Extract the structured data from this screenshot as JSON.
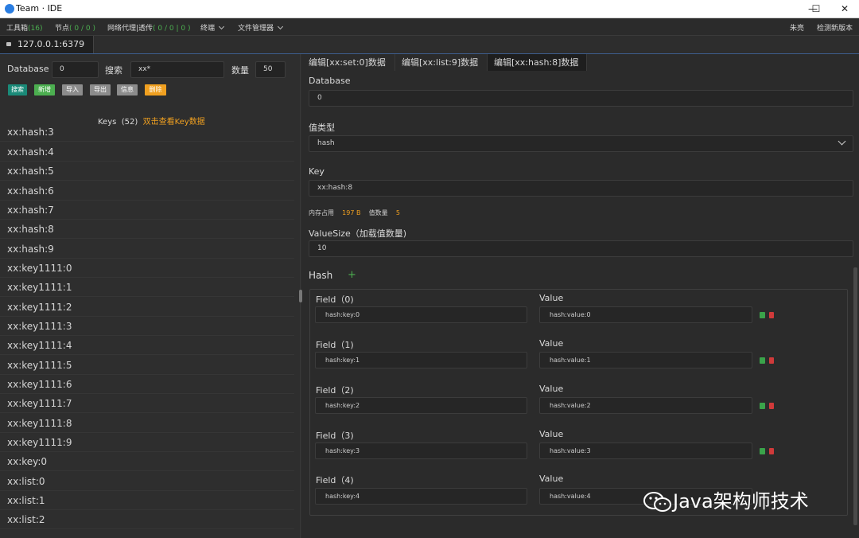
{
  "window": {
    "title": "Team · IDE",
    "minimize": "—",
    "maximize": "☐",
    "close": "✕"
  },
  "menubar": {
    "tools_label": "工具箱",
    "tools_count": "(16)",
    "nodes_label": "节点",
    "nodes_count": "( 0 / 0 )",
    "proxy_label": "网络代理|透传",
    "proxy_count": "( 0 / 0 | 0 )",
    "terminal": "终端",
    "filemanager": "文件管理器",
    "user": "朱亮",
    "update": "检测新版本"
  },
  "connection_tab": "127.0.0.1:6379",
  "left": {
    "database_label": "Database",
    "database_value": "0",
    "search_label": "搜索",
    "search_value": "xx*",
    "count_label": "数量",
    "count_value": "50",
    "buttons": [
      "搜索",
      "新增",
      "导入",
      "导出",
      "信息",
      "删除"
    ],
    "button_colors": [
      "#1a8a78",
      "#4caf50",
      "#8c8c8c",
      "#8c8c8c",
      "#8c8c8c",
      "#f0a020"
    ],
    "keys_title": "Keys",
    "keys_count": "(52)",
    "keys_hint": "双击查看Key数据",
    "keys": [
      "xx:hash:3",
      "xx:hash:4",
      "xx:hash:5",
      "xx:hash:6",
      "xx:hash:7",
      "xx:hash:8",
      "xx:hash:9",
      "xx:key1111:0",
      "xx:key1111:1",
      "xx:key1111:2",
      "xx:key1111:3",
      "xx:key1111:4",
      "xx:key1111:5",
      "xx:key1111:6",
      "xx:key1111:7",
      "xx:key1111:8",
      "xx:key1111:9",
      "xx:key:0",
      "xx:list:0",
      "xx:list:1",
      "xx:list:2"
    ]
  },
  "tabs": [
    "编辑[xx:set:0]数据",
    "编辑[xx:list:9]数据",
    "编辑[xx:hash:8]数据"
  ],
  "editor": {
    "database_label": "Database",
    "database_value": "0",
    "type_label": "值类型",
    "type_value": "hash",
    "key_label": "Key",
    "key_value": "xx:hash:8",
    "memory_label": "内存占用",
    "memory_value": "197 B",
    "count_label": "值数量",
    "count_value": "5",
    "valuesize_label": "ValueSize（加载值数量)",
    "valuesize_value": "10",
    "hash_label": "Hash",
    "add_icon": "+",
    "rows": [
      {
        "field_label": "Field（0)",
        "value_label": "Value",
        "field": "hash:key:0",
        "value": "hash:value:0"
      },
      {
        "field_label": "Field（1)",
        "value_label": "Value",
        "field": "hash:key:1",
        "value": "hash:value:1"
      },
      {
        "field_label": "Field（2)",
        "value_label": "Value",
        "field": "hash:key:2",
        "value": "hash:value:2"
      },
      {
        "field_label": "Field（3)",
        "value_label": "Value",
        "field": "hash:key:3",
        "value": "hash:value:3"
      },
      {
        "field_label": "Field（4)",
        "value_label": "Value",
        "field": "hash:key:4",
        "value": "hash:value:4"
      }
    ]
  },
  "watermark": "Java架构师技术"
}
